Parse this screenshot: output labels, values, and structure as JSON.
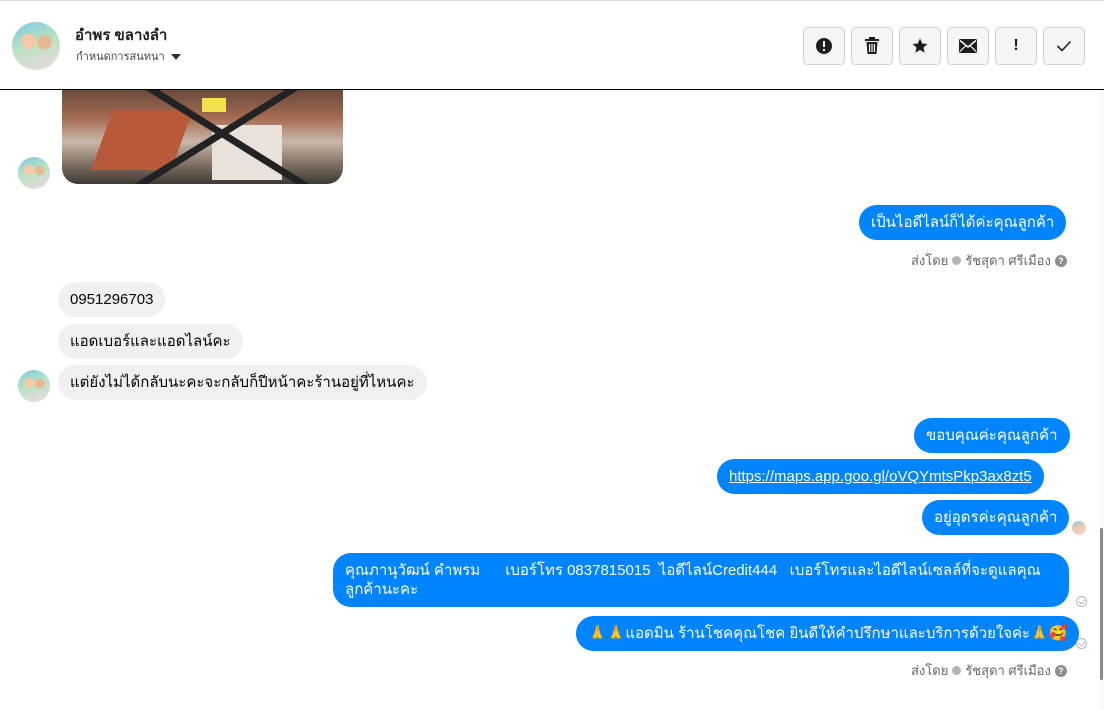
{
  "header": {
    "contact_name": "อำพร ขลางลำ",
    "subtitle": "กำหนดการสนทนา"
  },
  "toolbar": {
    "buttons": [
      {
        "icon": "alert-circle-icon"
      },
      {
        "icon": "trash-icon"
      },
      {
        "icon": "star-icon"
      },
      {
        "icon": "envelope-icon"
      },
      {
        "icon": "exclamation-icon",
        "label": "!"
      },
      {
        "icon": "checkmark-icon"
      }
    ]
  },
  "messages": {
    "m1": "เป็นไอดีไลน์ก็ได้ค่ะคุณลูกค้า",
    "sent_by_1": {
      "prefix": "ส่งโดย",
      "name": "รัชสุดา ศรีเมือง",
      "help": "?"
    },
    "m2": "0951296703",
    "m3": "แอดเบอร์และแอดไลน์คะ",
    "m4": "แต่ยังไม่ได้กลับนะคะจะกลับก็ปีหน้าคะร้านอยู่ที่ไหนคะ",
    "m5": "ขอบคุณค่ะคุณลูกค้า",
    "m6": "https://maps.app.goo.gl/oVQYmtsPkp3ax8zt5",
    "m7": "อยู่อุดรค่ะคุณลูกค้า",
    "m8_line1": "คุณภานุวัฒน์ คำพรม      เบอร์โทร 0837815015  ไอดีไลน์Credit444   เบอร์โทรและไอดีไลน์เซลล์ที่จะดูแลคุณ",
    "m8_line2": "ลูกค้านะคะ",
    "m9": "🙏🙏แอดมิน ร้านโชคคุณโชค ยินดีให้คำปรึกษาและบริการด้วยใจค่ะ🙏🥰",
    "sent_by_2": {
      "prefix": "ส่งโดย",
      "name": "รัชสุดา ศรีเมือง",
      "help": "?"
    }
  },
  "colors": {
    "outgoing": "#0084ff",
    "incoming": "#f0f0f0"
  }
}
